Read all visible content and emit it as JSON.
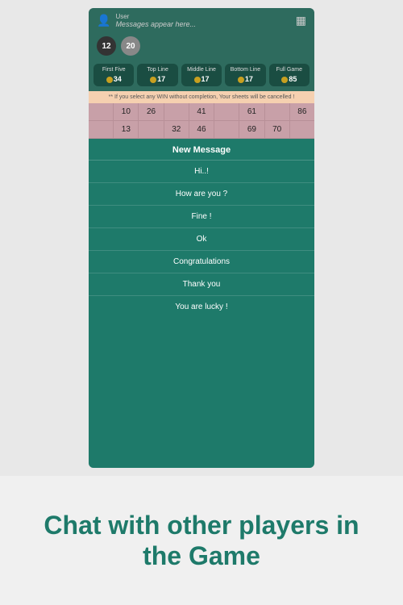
{
  "topbar": {
    "user_label": "User",
    "placeholder": "Messages appear here...",
    "chat_icon": "💬"
  },
  "badges": [
    {
      "value": "12",
      "type": "dark"
    },
    {
      "value": "20",
      "type": "gray"
    }
  ],
  "score_tabs": [
    {
      "label": "First Five",
      "value": "34"
    },
    {
      "label": "Top Line",
      "value": "17"
    },
    {
      "label": "Middle Line",
      "value": "17"
    },
    {
      "label": "Bottom Line",
      "value": "17"
    },
    {
      "label": "Full Game",
      "value": "85"
    }
  ],
  "warning": "** If you select any WIN without completion, Your sheets will be cancelled !",
  "grid_rows": [
    [
      "",
      "10",
      "26",
      "",
      "41",
      "",
      "61",
      "",
      "86"
    ],
    [
      "",
      "13",
      "",
      "32",
      "46",
      "",
      "69",
      "70",
      ""
    ]
  ],
  "message_list": {
    "header": "New Message",
    "items": [
      "Hi..!",
      "How are you ?",
      "Fine !",
      "Ok",
      "Congratulations",
      "Thank you",
      "You are lucky !"
    ]
  },
  "promo": {
    "text": "Chat with other players in the Game"
  }
}
